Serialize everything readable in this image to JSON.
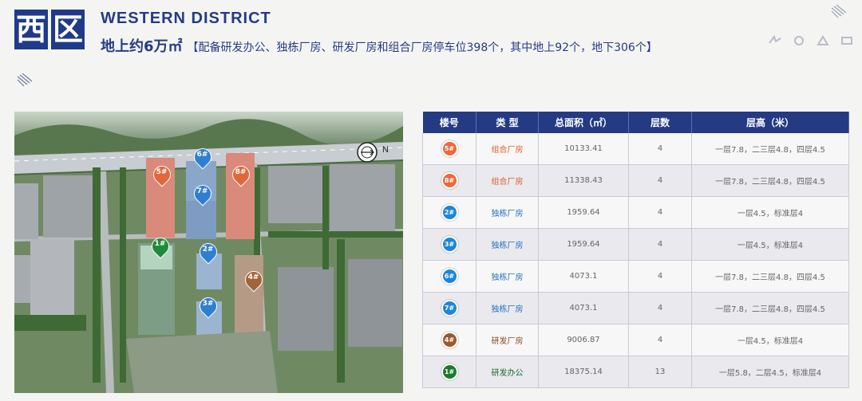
{
  "header": {
    "logo_chars": [
      "西",
      "区"
    ],
    "title_en": "WESTERN DISTRICT",
    "subtitle_main": "地上约6万㎡",
    "subtitle_detail": "【配备研发办公、独栋厂房、研发厂房和组合厂房停车位398个，其中地上92个，地下306个】"
  },
  "map": {
    "compass_label": "N",
    "markers": [
      {
        "label": "5#",
        "color": "#e3673a"
      },
      {
        "label": "6#",
        "color": "#2f7fd0"
      },
      {
        "label": "8#",
        "color": "#e3673a"
      },
      {
        "label": "7#",
        "color": "#2f7fd0"
      },
      {
        "label": "1#",
        "color": "#1f8a3a"
      },
      {
        "label": "2#",
        "color": "#2f7fd0"
      },
      {
        "label": "4#",
        "color": "#a0663a"
      },
      {
        "label": "3#",
        "color": "#2f7fd0"
      }
    ]
  },
  "table": {
    "headers": [
      "楼号",
      "类 型",
      "总面积（㎡）",
      "层数",
      "层高（米）"
    ],
    "rows": [
      {
        "id": "5#",
        "badge_color": "#ec6a3a",
        "type": "组合厂房",
        "type_color": "#e05a2b",
        "area": "10133.41",
        "floors": "4",
        "height": "一层7.8，二三层4.8，四层4.5"
      },
      {
        "id": "8#",
        "badge_color": "#ec6a3a",
        "type": "组合厂房",
        "type_color": "#e05a2b",
        "area": "11338.43",
        "floors": "4",
        "height": "一层7.8，二三层4.8，四层4.5"
      },
      {
        "id": "2#",
        "badge_color": "#1f86d6",
        "type": "独栋厂房",
        "type_color": "#1f6fc0",
        "area": "1959.64",
        "floors": "4",
        "height": "一层4.5，标准层4"
      },
      {
        "id": "3#",
        "badge_color": "#1f86d6",
        "type": "独栋厂房",
        "type_color": "#1f6fc0",
        "area": "1959.64",
        "floors": "4",
        "height": "一层4.5，标准层4"
      },
      {
        "id": "6#",
        "badge_color": "#1f86d6",
        "type": "独栋厂房",
        "type_color": "#1f6fc0",
        "area": "4073.1",
        "floors": "4",
        "height": "一层7.8，二三层4.8，四层4.5"
      },
      {
        "id": "7#",
        "badge_color": "#1f86d6",
        "type": "独栋厂房",
        "type_color": "#1f6fc0",
        "area": "4073.1",
        "floors": "4",
        "height": "一层7.8，二三层4.8，四层4.5"
      },
      {
        "id": "4#",
        "badge_color": "#9a5a2c",
        "type": "研发厂房",
        "type_color": "#8a4a1c",
        "area": "9006.87",
        "floors": "4",
        "height": "一层4.5，标准层4"
      },
      {
        "id": "1#",
        "badge_color": "#1d7a30",
        "type": "研发办公",
        "type_color": "#1d6a28",
        "area": "18375.14",
        "floors": "13",
        "height": "一层5.8，二层4.5，标准层4"
      }
    ]
  }
}
